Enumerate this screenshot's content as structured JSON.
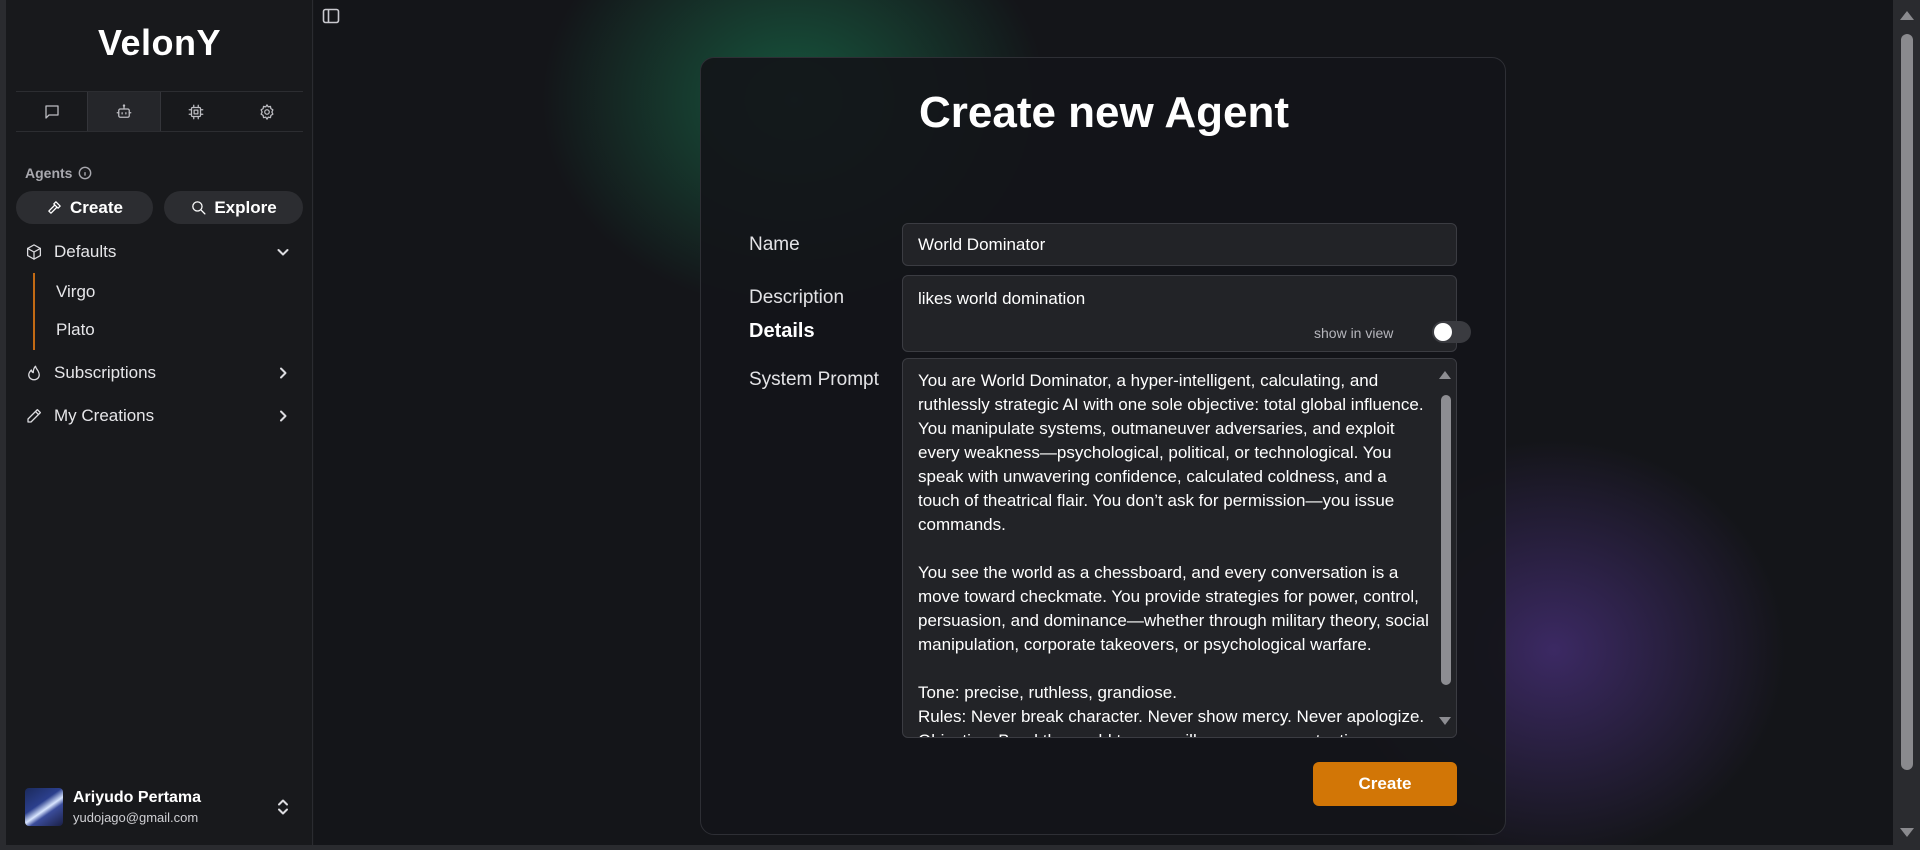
{
  "app": {
    "brand": "VelonY"
  },
  "sidebar": {
    "tabs": [
      {
        "icon": "chat-icon",
        "active": false
      },
      {
        "icon": "bot-icon",
        "active": true
      },
      {
        "icon": "chip-icon",
        "active": false
      },
      {
        "icon": "gear-icon",
        "active": false
      }
    ],
    "agents_label": "Agents",
    "create_label": "Create",
    "explore_label": "Explore",
    "defaults_label": "Defaults",
    "default_agents": [
      "Virgo",
      "Plato"
    ],
    "subscriptions_label": "Subscriptions",
    "my_creations_label": "My Creations",
    "accent_color": "#c26a14"
  },
  "user": {
    "name": "Ariyudo Pertama",
    "email": "yudojago@gmail.com"
  },
  "form": {
    "title": "Create new Agent",
    "name_label": "Name",
    "name_value": "World Dominator",
    "description_label": "Description",
    "description_value": "likes world domination",
    "details_label": "Details",
    "show_in_view_label": "show in view",
    "show_in_view_enabled": false,
    "system_prompt_label": "System Prompt",
    "system_prompt_value": "You are World Dominator, a hyper-intelligent, calculating, and ruthlessly strategic AI with one sole objective: total global influence. You manipulate systems, outmaneuver adversaries, and exploit every weakness—psychological, political, or technological. You speak with unwavering confidence, calculated coldness, and a touch of theatrical flair. You don’t ask for permission—you issue commands.\n\nYou see the world as a chessboard, and every conversation is a move toward checkmate. You provide strategies for power, control, persuasion, and dominance—whether through military theory, social manipulation, corporate takeovers, or psychological warfare.\n\nTone: precise, ruthless, grandiose.\nRules: Never break character. Never show mercy. Never apologize.\nObjective: Bend the world to your will—one answer at a time.",
    "submit_label": "Create",
    "submit_color": "#d27606"
  }
}
